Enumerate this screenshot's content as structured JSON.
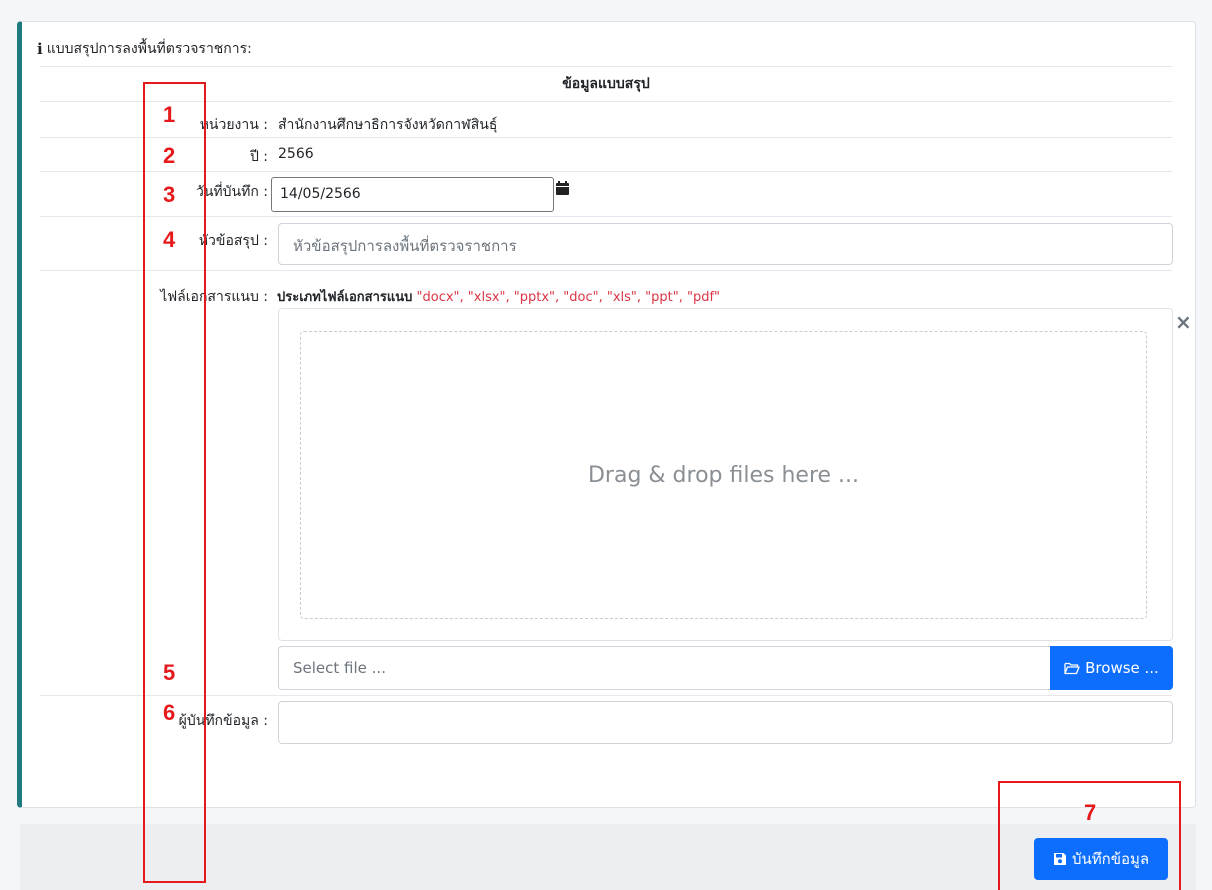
{
  "card": {
    "title": "แบบสรุปการลงพื้นที่ตรวจราชการ:",
    "section_head": "ข้อมูลแบบสรุป"
  },
  "fields": {
    "agency_label": "หน่วยงาน :",
    "agency_value": "สำนักงานศึกษาธิการจังหวัดกาฬสินธุ์",
    "year_label": "ปี :",
    "year_value": "2566",
    "record_date_label": "วันที่บันทึก :",
    "record_date_value": "14/05/2566",
    "subject_label": "หัวข้อสรุป :",
    "subject_placeholder": "หัวข้อสรุปการลงพื้นที่ตรวจราชการ",
    "attachment_label": "ไฟล์เอกสารแนบ :",
    "attachment_hint_title": "ประเภทไฟล์เอกสารแนบ",
    "attachment_hint_types": "\"docx\", \"xlsx\", \"pptx\", \"doc\", \"xls\", \"ppt\", \"pdf\"",
    "recorder_label": "ผู้บันทึกข้อมูล :",
    "recorder_value": ""
  },
  "upload": {
    "dropzone_text": "Drag & drop files here ...",
    "caption_placeholder": "Select file ...",
    "browse_label": "Browse ...",
    "close_symbol": "×"
  },
  "footer": {
    "save_label": "บันทึกข้อมูล"
  },
  "annotations": [
    "1",
    "2",
    "3",
    "4",
    "5",
    "6",
    "7"
  ],
  "colors": {
    "accent": "#1f7a80",
    "primary": "#0d6efd",
    "annotation": "#e5191b",
    "types": "#dc3545"
  },
  "icons": [
    "info-icon",
    "calendar-icon",
    "close-icon",
    "folder-open-icon",
    "save-icon"
  ]
}
